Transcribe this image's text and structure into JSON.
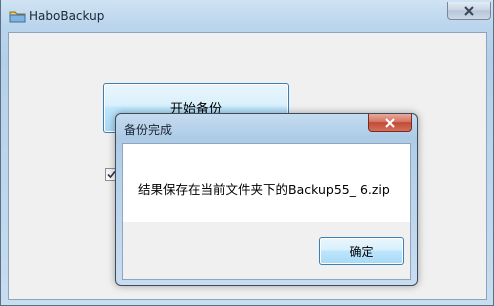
{
  "window": {
    "title": "HaboBackup"
  },
  "main": {
    "start_button_label": "开始备份",
    "checkbox_checked": true
  },
  "dialog": {
    "title": "备份完成",
    "message": "结果保存在当前文件夹下的Backup55_ 6.zip",
    "ok_label": "确定"
  },
  "colors": {
    "frame": "#b9d4ec",
    "client": "#f0f0f0",
    "close_red": "#c24a34",
    "button_border": "#3c7fb1"
  }
}
